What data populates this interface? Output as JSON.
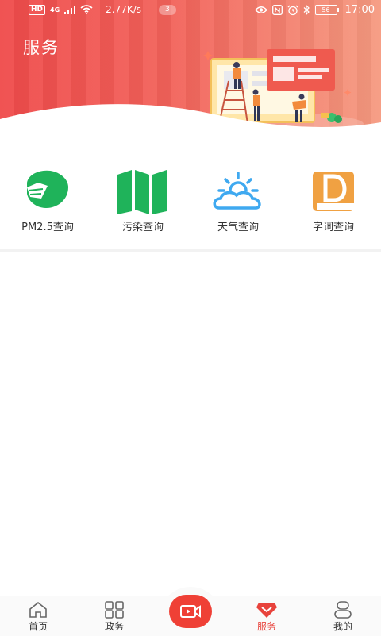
{
  "status_bar": {
    "hd_badge": "HD",
    "network_type": "4G",
    "speed": "2.77K/s",
    "notification_count": "3",
    "battery_level": "56",
    "time": "17:00"
  },
  "header": {
    "title": "服务"
  },
  "services": [
    {
      "label": "PM2.5查询",
      "icon": "face-mask-icon",
      "color": "#1fb35a"
    },
    {
      "label": "污染查询",
      "icon": "map-icon",
      "color": "#1fb35a"
    },
    {
      "label": "天气查询",
      "icon": "weather-icon",
      "color": "#3fa9f0"
    },
    {
      "label": "字词查询",
      "icon": "dictionary-icon",
      "color": "#f0a142"
    }
  ],
  "bottom_nav": {
    "items": [
      {
        "label": "首页",
        "icon": "home-icon"
      },
      {
        "label": "政务",
        "icon": "grid-icon"
      },
      {
        "label": "",
        "icon": "video-icon"
      },
      {
        "label": "服务",
        "icon": "service-icon",
        "active": true
      },
      {
        "label": "我的",
        "icon": "profile-icon"
      }
    ],
    "active_color": "#e8433c"
  }
}
